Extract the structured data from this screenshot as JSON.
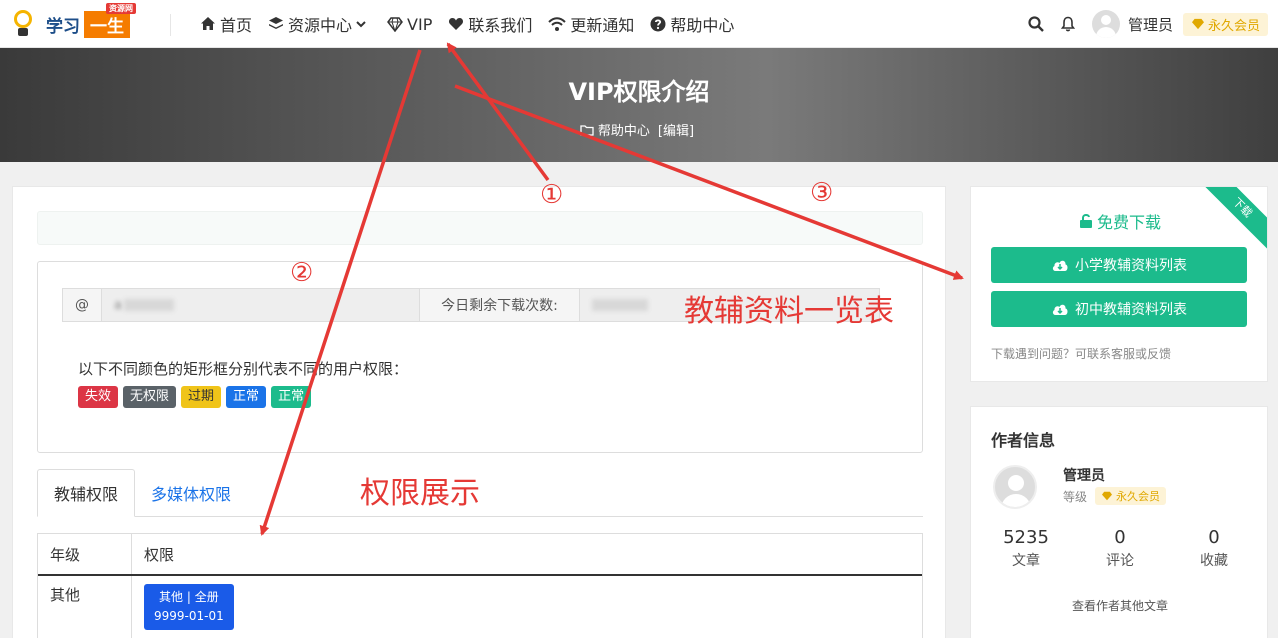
{
  "logo": {
    "text": "学习",
    "box": "一生",
    "tag": "资源网"
  },
  "nav": {
    "items": [
      {
        "label": "首页",
        "icon": "home-icon"
      },
      {
        "label": "资源中心",
        "icon": "layers-icon"
      },
      {
        "label": "VIP",
        "icon": "diamond-icon"
      },
      {
        "label": "联系我们",
        "icon": "heart-icon"
      },
      {
        "label": "更新通知",
        "icon": "wifi-icon"
      },
      {
        "label": "帮助中心",
        "icon": "question-icon"
      }
    ],
    "user": "管理员",
    "vip": "永久会员"
  },
  "hero": {
    "title": "VIP权限介绍",
    "category": "帮助中心",
    "edit": "[编辑]"
  },
  "panel": {
    "at": "@",
    "account_value": "a",
    "downloads_label": "今日剩余下载次数:",
    "downloads_value": "",
    "desc": "以下不同颜色的矩形框分别代表不同的用户权限：",
    "badges": [
      {
        "label": "失效",
        "color": "#dc3545"
      },
      {
        "label": "无权限",
        "color": "#5a6268"
      },
      {
        "label": "过期",
        "color": "#f0c419"
      },
      {
        "label": "正常",
        "color": "#1a73e8"
      },
      {
        "label": "正常",
        "color": "#1cbb8c"
      }
    ]
  },
  "tabs": [
    {
      "label": "教辅权限"
    },
    {
      "label": "多媒体权限"
    }
  ],
  "table": {
    "headers": [
      "年级",
      "权限"
    ],
    "rows": [
      {
        "grade": "其他",
        "perm_line1": "其他 | 全册",
        "perm_line2": "9999-01-01"
      }
    ]
  },
  "sidebar": {
    "free_download": "免费下载",
    "ribbon": "下载",
    "btn_primary": "小学教辅资料列表",
    "btn_junior": "初中教辅资料列表",
    "tip": "下载遇到问题？可联系客服或反馈"
  },
  "author": {
    "title": "作者信息",
    "name": "管理员",
    "level_label": "等级",
    "vip": "永久会员",
    "stats": [
      {
        "value": "5235",
        "label": "文章"
      },
      {
        "value": "0",
        "label": "评论"
      },
      {
        "value": "0",
        "label": "收藏"
      }
    ],
    "more": "查看作者其他文章"
  },
  "annotations": {
    "n1": "①",
    "n2": "②",
    "n3": "③",
    "label_list": "教辅资料一览表",
    "label_perm": "权限展示"
  },
  "colors": {
    "accent": "#1cbb8c",
    "link": "#1a73e8",
    "annotation": "#e53935",
    "vip": "#e0a800"
  }
}
